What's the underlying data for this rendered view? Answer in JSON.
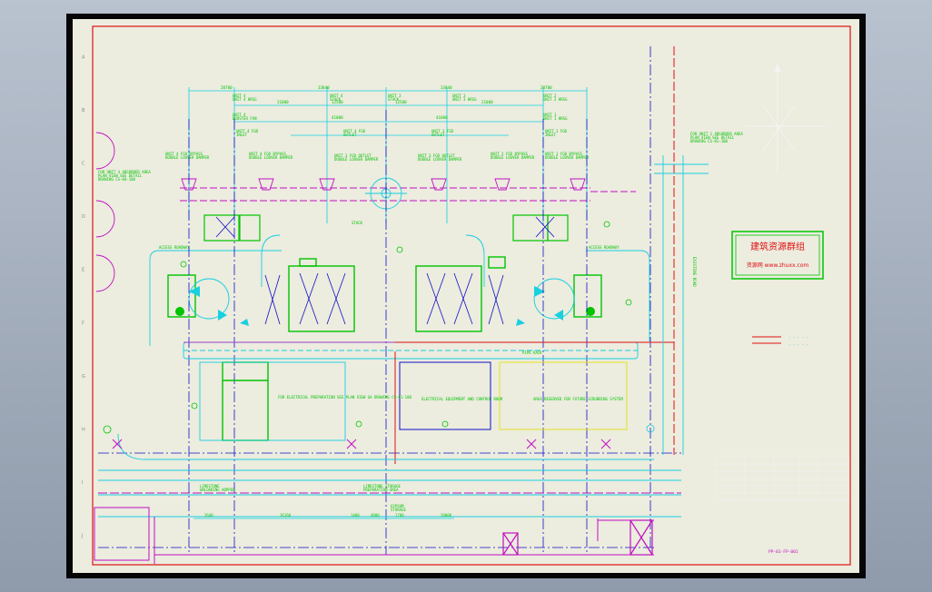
{
  "sheet": {
    "border_rows": [
      "A",
      "B",
      "C",
      "D",
      "E",
      "F",
      "G",
      "H",
      "I",
      "J"
    ]
  },
  "stamp": {
    "title": "建筑资源群组",
    "url": "资源网 www.zhuxx.com"
  },
  "labels": {
    "right_road": "EXISTING ROAD",
    "access_roadway_left": "ACCESS ROADWAY",
    "access_roadway_right": "ACCESS ROADWAY",
    "pipe_rack": "PIPE RACK",
    "bldg_left": "FOR ELECTRICAL PREPARATION  SEE PLAN VIEW  GA DRAWING CS-01-100",
    "bldg_mid": "ELECTRICAL EQUIPMENT AND CONTROL ROOM",
    "bldg_right": "AREA RESERVED FOR FUTURE SCRUBBING SYSTEM",
    "unit1_hrsg": "UNIT 1 HRSG",
    "unit2_hrsg": "UNIT 2 HRSG",
    "unit3_hrsg": "UNIT 3 HRSG",
    "unit4_hrsg": "UNIT 4 HRSG",
    "stack_center": "STACK",
    "title_mark": "PP-01-FP-001"
  },
  "colors": {
    "cad_cyan": "#18d0e0",
    "cad_green": "#00c400",
    "cad_magenta": "#c010c0",
    "cad_red": "#e01010",
    "cad_blue": "#1010c8",
    "cad_yellow": "#e4e420"
  }
}
